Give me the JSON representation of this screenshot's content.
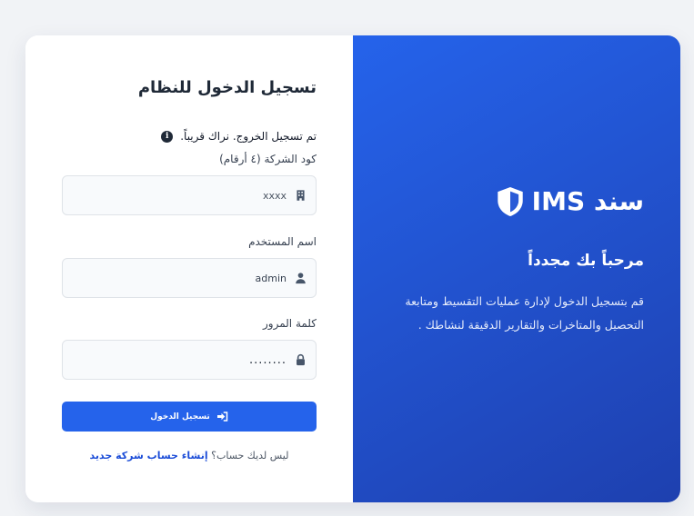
{
  "login": {
    "title": "تسجيل الدخول للنظام",
    "alert": "تم تسجيل الخروج. نراك قريباً.",
    "company_code": {
      "label": "كود الشركة (٤ أرقام)",
      "placeholder": "xxxx"
    },
    "username": {
      "label": "اسم المستخدم",
      "value": "admin"
    },
    "password": {
      "label": "كلمة المرور",
      "value": "........"
    },
    "submit_label": "تسجيل الدخول",
    "signup_prompt": "ليس لديك حساب؟",
    "signup_link": "إنشاء حساب شركة جديد"
  },
  "brand": {
    "name": "سند IMS",
    "welcome": "مرحباً بك مجدداً",
    "description": "قم بتسجيل الدخول لإدارة عمليات التقسيط ومتابعة التحصيل والمتاخرات والتقارير الدقيقة لنشاطك ."
  },
  "colors": {
    "accent": "#2563eb",
    "panel_gradient_end": "#1e40af",
    "background": "#f1f3f6"
  },
  "icons": {
    "alert": "info-icon",
    "company_code": "building-icon",
    "username": "user-icon",
    "password": "lock-icon",
    "submit": "sign-in-icon",
    "brand": "shield-icon"
  }
}
